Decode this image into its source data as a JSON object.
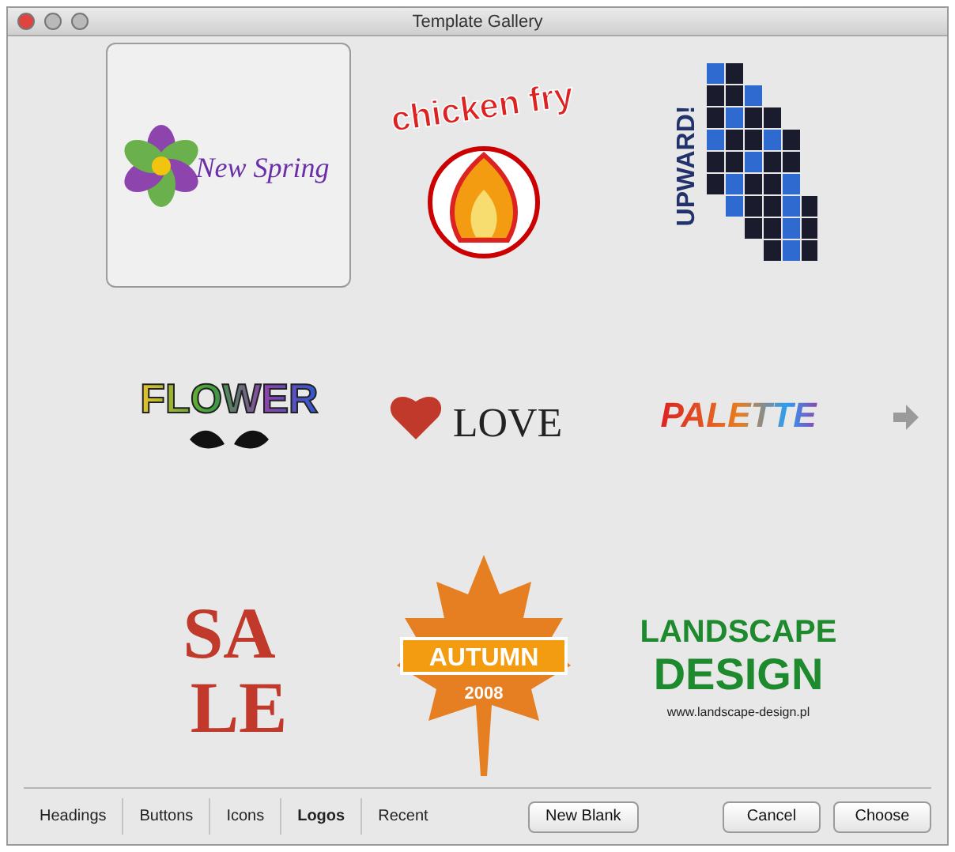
{
  "window": {
    "title": "Template Gallery"
  },
  "templates": [
    {
      "kind": "spring",
      "selected": true,
      "texts": [
        "New Spring"
      ]
    },
    {
      "kind": "chicken",
      "selected": false,
      "texts": [
        "chicken fry"
      ]
    },
    {
      "kind": "upward",
      "selected": false,
      "texts": [
        "UPWARD!"
      ]
    },
    {
      "kind": "flower",
      "selected": false,
      "texts": [
        "FLOWER"
      ]
    },
    {
      "kind": "love",
      "selected": false,
      "texts": [
        "LOVE"
      ]
    },
    {
      "kind": "palette",
      "selected": false,
      "texts": [
        "PALETTE"
      ]
    },
    {
      "kind": "sale",
      "selected": false,
      "texts": [
        "SA",
        "LE"
      ]
    },
    {
      "kind": "autumn",
      "selected": false,
      "texts": [
        "AUTUMN",
        "2008"
      ]
    },
    {
      "kind": "landscape",
      "selected": false,
      "texts": [
        "LANDSCAPE",
        "DESIGN",
        "www.landscape-design.pl"
      ]
    }
  ],
  "categories": [
    {
      "label": "Headings",
      "selected": false
    },
    {
      "label": "Buttons",
      "selected": false
    },
    {
      "label": "Icons",
      "selected": false
    },
    {
      "label": "Logos",
      "selected": true
    },
    {
      "label": "Recent",
      "selected": false
    }
  ],
  "actions": [
    {
      "label": "New Blank"
    }
  ],
  "buttons": [
    {
      "label": "Cancel"
    },
    {
      "label": "Choose"
    }
  ]
}
